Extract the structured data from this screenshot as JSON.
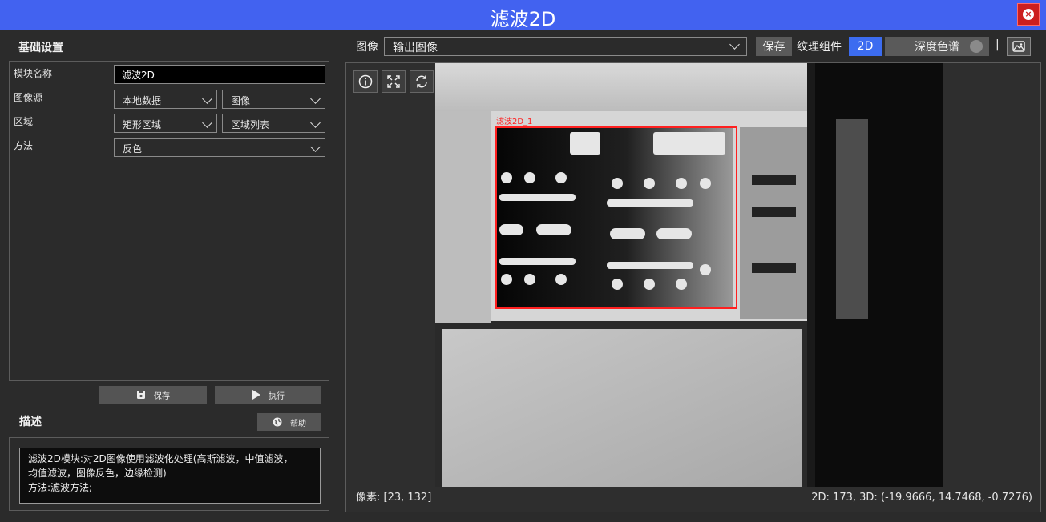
{
  "window": {
    "title": "滤波2D"
  },
  "left": {
    "section_title": "基础设置",
    "rows": {
      "module_name_label": "模块名称",
      "module_name_value": "滤波2D",
      "image_source_label": "图像源",
      "image_source_select1": "本地数据",
      "image_source_select2": "图像",
      "region_label": "区域",
      "region_select1": "矩形区域",
      "region_select2": "区域列表",
      "method_label": "方法",
      "method_select": "反色"
    },
    "save_label": "保存",
    "run_label": "执行",
    "desc_title": "描述",
    "help_label": "帮助",
    "description_lines": [
      "滤波2D模块:对2D图像使用滤波化处理(高斯滤波，中值滤波，",
      "均值滤波，图像反色，边缘检测)",
      "方法:滤波方法;"
    ]
  },
  "right": {
    "image_label": "图像",
    "image_select": "输出图像",
    "save_label": "保存",
    "texture_label": "纹理组件",
    "mode_2d": "2D",
    "depth_select": "深度色谱",
    "separator": "|",
    "pixel_status": "像素: [23, 132]",
    "coord_status": "2D: 173, 3D: (-19.9666, 14.7468, -0.7276)",
    "roi_label": "滤波2D_1"
  },
  "colors": {
    "title_bar": "#4262f0",
    "close_button": "#cc1f1f",
    "accent_2d": "#3c6cf0",
    "roi": "#ff2020"
  }
}
